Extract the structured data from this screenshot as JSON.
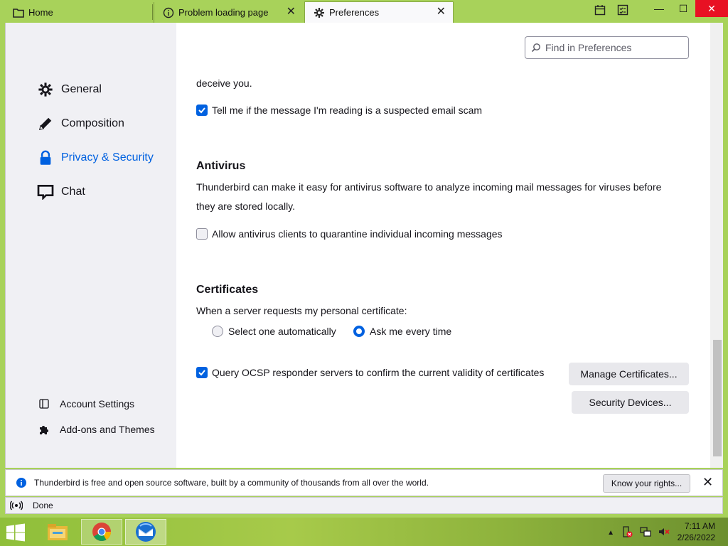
{
  "tabs": [
    {
      "label": "Home"
    },
    {
      "label": "Problem loading page"
    },
    {
      "label": "Preferences"
    }
  ],
  "sidebar": {
    "categories": [
      {
        "label": "General"
      },
      {
        "label": "Composition"
      },
      {
        "label": "Privacy & Security"
      },
      {
        "label": "Chat"
      }
    ],
    "bottom": [
      {
        "label": "Account Settings"
      },
      {
        "label": "Add-ons and Themes"
      }
    ]
  },
  "search": {
    "placeholder": "Find in Preferences"
  },
  "main": {
    "cut_text": "deceive you.",
    "scam_checkbox": {
      "label": "Tell me if the message I'm reading is a suspected email scam",
      "checked": true
    },
    "antivirus": {
      "heading": "Antivirus",
      "desc_line1": "Thunderbird can make it easy for antivirus software to analyze incoming mail messages for viruses before",
      "desc_line2": "they are stored locally.",
      "checkbox": {
        "label": "Allow antivirus clients to quarantine individual incoming messages",
        "checked": false
      }
    },
    "certificates": {
      "heading": "Certificates",
      "desc": "When a server requests my personal certificate:",
      "radio_auto": {
        "label": "Select one automatically",
        "selected": false
      },
      "radio_ask": {
        "label": "Ask me every time",
        "selected": true
      },
      "ocsp": {
        "label": "Query OCSP responder servers to confirm the current validity of certificates",
        "checked": true
      },
      "manage_button": "Manage Certificates...",
      "security_button": "Security Devices..."
    }
  },
  "notification": {
    "message": "Thunderbird is free and open source software, built by a community of thousands from all over the world.",
    "button": "Know your rights..."
  },
  "status": {
    "text": "Done"
  },
  "clock": {
    "time": "7:11 AM",
    "date": "2/26/2022"
  },
  "colors": {
    "accent": "#0061e0",
    "close_red": "#e81123"
  }
}
